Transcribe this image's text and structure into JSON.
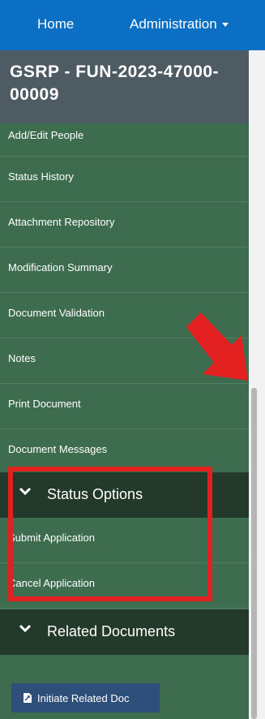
{
  "topbar": {
    "home": "Home",
    "admin": "Administration"
  },
  "sidebar": {
    "title": "GSRP - FUN-2023-47000-00009",
    "items": [
      {
        "label": "Add/Edit People"
      },
      {
        "label": "Status History"
      },
      {
        "label": "Attachment Repository"
      },
      {
        "label": "Modification Summary"
      },
      {
        "label": "Document Validation"
      },
      {
        "label": "Notes"
      },
      {
        "label": "Print Document"
      },
      {
        "label": "Document Messages"
      }
    ],
    "status_options": {
      "label": "Status Options",
      "items": [
        {
          "label": "Submit Application"
        },
        {
          "label": "Cancel Application"
        }
      ]
    },
    "related_documents": {
      "label": "Related Documents",
      "button": "Initiate Related Doc"
    }
  },
  "annotation_colors": {
    "highlight": "#e32020",
    "arrow": "#e32020"
  }
}
